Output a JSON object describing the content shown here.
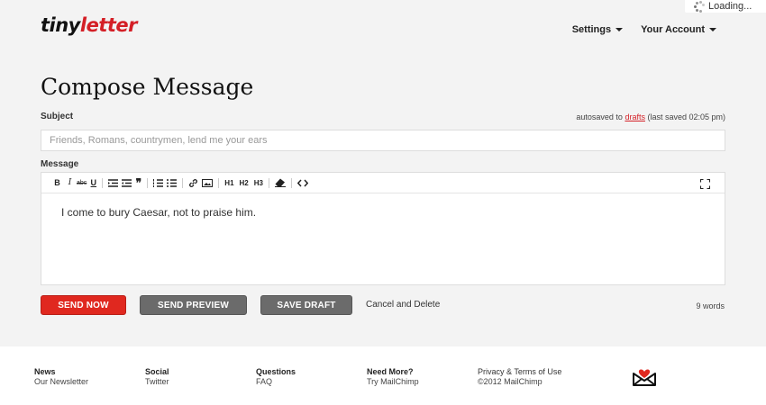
{
  "loading": {
    "text": "Loading..."
  },
  "header": {
    "logo_prefix": "tiny",
    "logo_suffix": "letter",
    "nav": [
      {
        "label": "Settings"
      },
      {
        "label": "Your Account"
      }
    ]
  },
  "compose": {
    "title": "Compose Message",
    "subject_label": "Subject",
    "autosave_prefix": "autosaved to ",
    "autosave_link": "drafts",
    "autosave_suffix": " (last saved 02:05 pm)",
    "subject_placeholder": "Friends, Romans, countrymen, lend me your ears",
    "subject_value": "",
    "message_label": "Message",
    "message_body": "I come to bury Caesar, not to praise him.",
    "toolbar": {
      "bold": "B",
      "italic": "I",
      "strike": "abc",
      "underline": "U",
      "h1": "H1",
      "h2": "H2",
      "h3": "H3",
      "icons": [
        "indent-icon",
        "outdent-icon",
        "quote-icon",
        "ordered-list-icon",
        "unordered-list-icon",
        "link-icon",
        "image-icon",
        "eraser-icon",
        "code-icon",
        "fullscreen-icon"
      ]
    }
  },
  "actions": {
    "send_now": "SEND NOW",
    "send_preview": "SEND PREVIEW",
    "save_draft": "SAVE DRAFT",
    "cancel": "Cancel and Delete",
    "word_count": "9 words"
  },
  "footer": {
    "columns": [
      {
        "heading": "News",
        "link": "Our Newsletter"
      },
      {
        "heading": "Social",
        "link": "Twitter"
      },
      {
        "heading": "Questions",
        "link": "FAQ"
      },
      {
        "heading": "Need More?",
        "link": "Try MailChimp"
      },
      {
        "heading": "Privacy & Terms of Use",
        "link": "©2012 MailChimp"
      }
    ]
  },
  "colors": {
    "brand_red": "#d41f26",
    "send_red": "#e0281f",
    "button_gray": "#6b6b6b"
  }
}
